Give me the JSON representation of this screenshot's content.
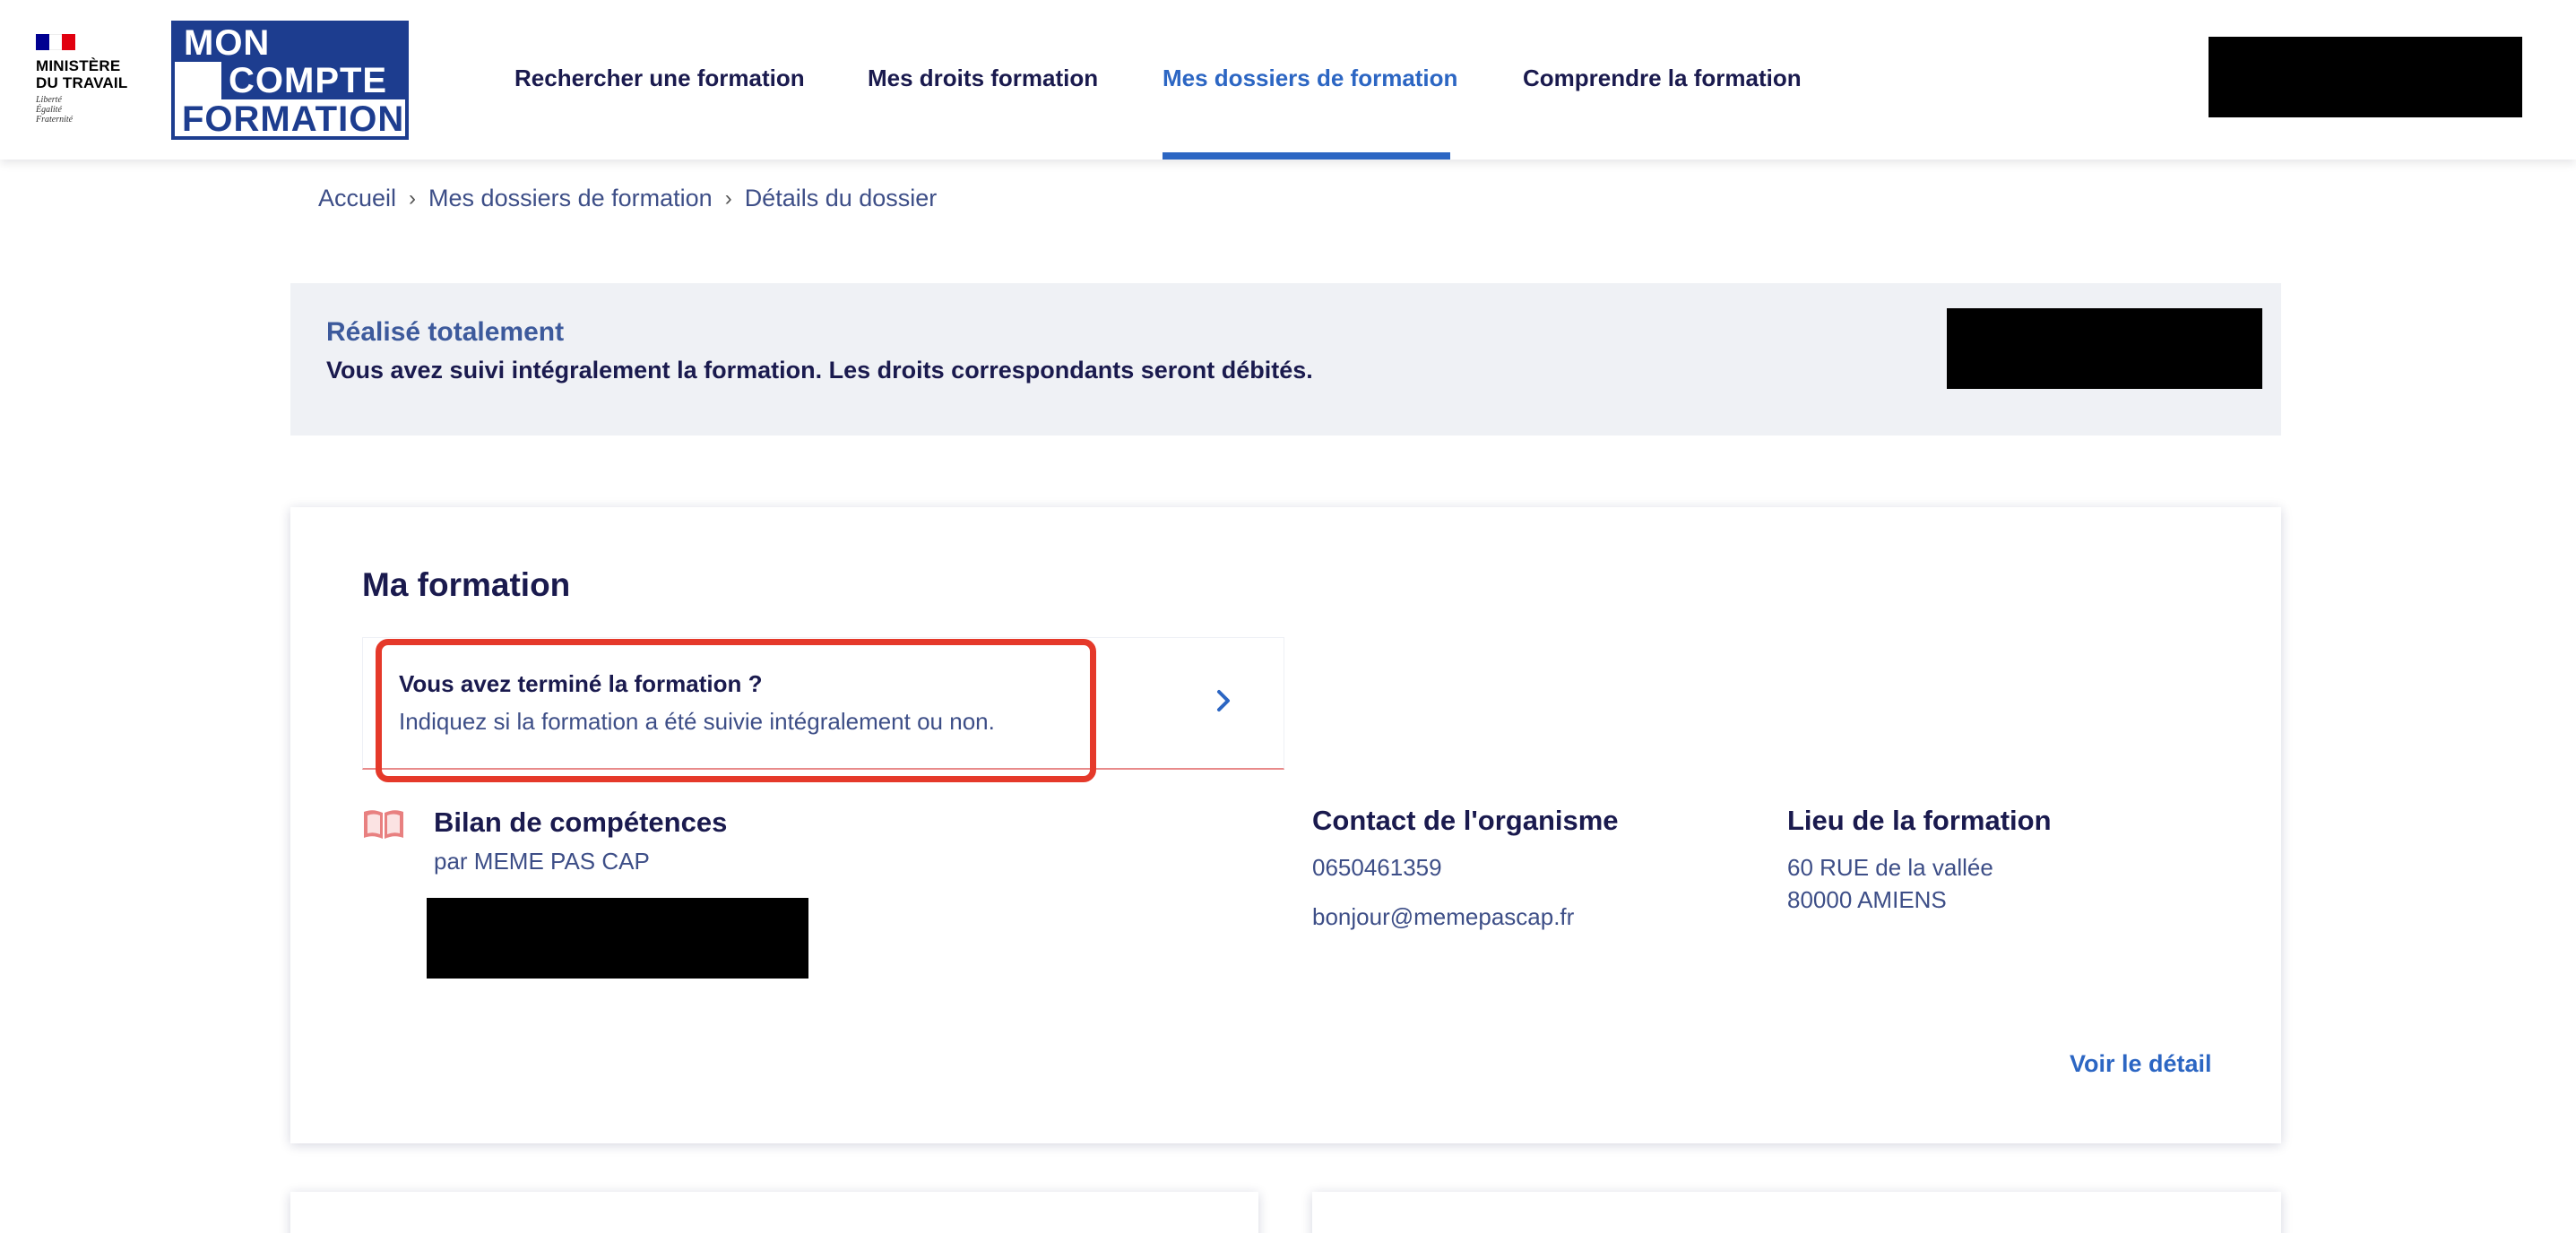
{
  "header": {
    "ministry": {
      "name_line1": "MINISTÈRE",
      "name_line2": "DU TRAVAIL",
      "motto": [
        "Liberté",
        "Égalité",
        "Fraternité"
      ]
    },
    "logo": {
      "line1": "MON",
      "line2": "COMPTE",
      "line3": "FORMATION"
    },
    "nav": [
      {
        "label": "Rechercher une formation",
        "active": false
      },
      {
        "label": "Mes droits formation",
        "active": false
      },
      {
        "label": "Mes dossiers de formation",
        "active": true
      },
      {
        "label": "Comprendre la formation",
        "active": false
      }
    ]
  },
  "breadcrumb": [
    "Accueil",
    "Mes dossiers de formation",
    "Détails du dossier"
  ],
  "status": {
    "title": "Réalisé totalement",
    "text": "Vous avez suivi intégralement la formation. Les droits correspondants seront débités."
  },
  "formation_card": {
    "title": "Ma formation",
    "alert": {
      "title": "Vous avez terminé la formation ?",
      "text": "Indiquez si la formation a été suivie intégralement ou non."
    },
    "formation": {
      "name": "Bilan de compétences",
      "organisme": "par MEME PAS CAP"
    },
    "contact": {
      "title": "Contact de l'organisme",
      "phone": "0650461359",
      "email": "bonjour@memepascap.fr"
    },
    "lieu": {
      "title": "Lieu de la formation",
      "address1": "60 RUE de la vallée",
      "address2": "80000 AMIENS"
    },
    "detail_link": "Voir le détail"
  },
  "colors": {
    "primary_navy": "#1a1a4e",
    "accent_blue": "#2c66c3",
    "highlight_red": "#e5392a",
    "banner_bg": "#eff1f5"
  }
}
